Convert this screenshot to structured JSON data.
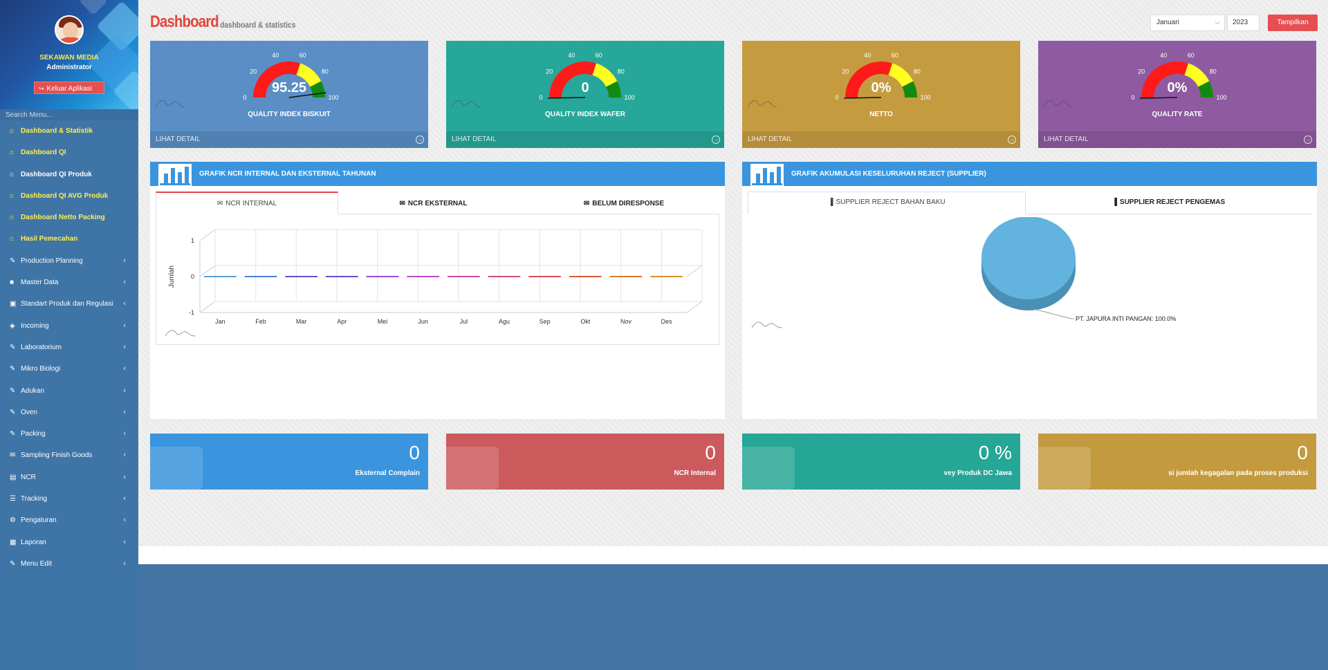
{
  "sidebar": {
    "company": "SEKAWAN MEDIA",
    "role": "Administrator",
    "logout_label": "Keluar Aplikasi",
    "search_placeholder": "Search Menu...",
    "items": [
      {
        "label": "Dashboard & Statistik",
        "icon": "home-icon"
      },
      {
        "label": "Dashboard QI",
        "icon": "home-icon"
      },
      {
        "label": "Dashboard QI Produk",
        "icon": "home-icon"
      },
      {
        "label": "Dashboard QI AVG Produk",
        "icon": "home-icon"
      },
      {
        "label": "Dashboard Netto Packing",
        "icon": "home-icon"
      },
      {
        "label": "Hasil Pemecahan",
        "icon": "home-icon"
      },
      {
        "label": "Production Planning",
        "icon": "edit-icon"
      },
      {
        "label": "Master Data",
        "icon": "folder-icon"
      },
      {
        "label": "Standart Produk dan Regulasi",
        "icon": "gift-icon"
      },
      {
        "label": "Incoming",
        "icon": "cube-icon"
      },
      {
        "label": "Laboratorium",
        "icon": "edit-icon"
      },
      {
        "label": "Mikro Biologi",
        "icon": "edit-icon"
      },
      {
        "label": "Adukan",
        "icon": "edit-icon"
      },
      {
        "label": "Oven",
        "icon": "edit-icon"
      },
      {
        "label": "Packing",
        "icon": "edit-icon"
      },
      {
        "label": "Sampling Finish Goods",
        "icon": "envelope-icon"
      },
      {
        "label": "NCR",
        "icon": "window-icon"
      },
      {
        "label": "Tracking",
        "icon": "list-icon"
      },
      {
        "label": "Pengaturan",
        "icon": "gear-icon"
      },
      {
        "label": "Laporan",
        "icon": "calendar-icon"
      },
      {
        "label": "Menu Edit",
        "icon": "edit-icon"
      }
    ]
  },
  "header": {
    "title": "Dashboard",
    "subtitle": "dashboard & statistics",
    "month": "Januari",
    "year": "2023",
    "show_label": "Tampilkan"
  },
  "gauges": [
    {
      "name": "QUALITY INDEX BISKUIT",
      "value_text": "95.25",
      "value": 95.25,
      "color": "#5a8ec5",
      "footer": "LIHAT DETAIL"
    },
    {
      "name": "QUALITY INDEX WAFER",
      "value_text": "0",
      "value": 0,
      "color": "#27a799",
      "footer": "LIHAT DETAIL"
    },
    {
      "name": "NETTO",
      "value_text": "0%",
      "value": 0,
      "color": "#c59b40",
      "footer": "LIHAT DETAIL"
    },
    {
      "name": "QUALITY RATE",
      "value_text": "0%",
      "value": 0,
      "color": "#8e5aa0",
      "footer": "LIHAT DETAIL"
    }
  ],
  "gauge_ticks": [
    "0",
    "20",
    "40",
    "60",
    "80",
    "100"
  ],
  "ncr_panel": {
    "title": "GRAFIK NCR INTERNAL DAN EKSTERNAL TAHUNAN",
    "tabs": [
      "NCR INTERNAL",
      "NCR EKSTERNAL",
      "BELUM DIRESPONSE"
    ],
    "active_tab": 0
  },
  "reject_panel": {
    "title": "GRAFIK AKUMULASI KESELURUHAN REJECT (SUPPLIER)",
    "tabs": [
      "SUPPLIER REJECT BAHAN BAKU",
      "SUPPLIER REJECT PENGEMAS"
    ],
    "active_tab": 0
  },
  "chart_data": [
    {
      "type": "bar",
      "ylabel": "Jumlah",
      "categories": [
        "Jan",
        "Feb",
        "Mar",
        "Apr",
        "Mei",
        "Jun",
        "Jul",
        "Agu",
        "Sep",
        "Okt",
        "Nov",
        "Des"
      ],
      "values": [
        0,
        0,
        0,
        0,
        0,
        0,
        0,
        0,
        0,
        0,
        0,
        0
      ],
      "ylim": [
        -1,
        1
      ],
      "yticks": [
        "1",
        "0",
        "-1"
      ],
      "colors": [
        "#5b9bd5",
        "#4a7fd8",
        "#5a54c8",
        "#6a4ad0",
        "#9b4ad0",
        "#b84ac8",
        "#c84aa8",
        "#d04a80",
        "#d84a5a",
        "#d85a3a",
        "#d87a2a",
        "#d8902a"
      ],
      "grid": true
    },
    {
      "type": "pie",
      "slices": [
        {
          "label": "PT. JAPURA INTI PANGAN: 100.0%",
          "value": 100.0
        }
      ],
      "color": "#62b3dd"
    }
  ],
  "stats": [
    {
      "value": "0",
      "label": "Eksternal Complain",
      "color": "#3a95de"
    },
    {
      "value": "0",
      "label": "NCR Internal",
      "color": "#cc5a5d"
    },
    {
      "value": "0 %",
      "label": "vey Produk DC Jawa",
      "color": "#26a696"
    },
    {
      "value": "0",
      "label": "si jumlah kegagalan pada proses produksi",
      "color": "#c49a3f"
    }
  ]
}
